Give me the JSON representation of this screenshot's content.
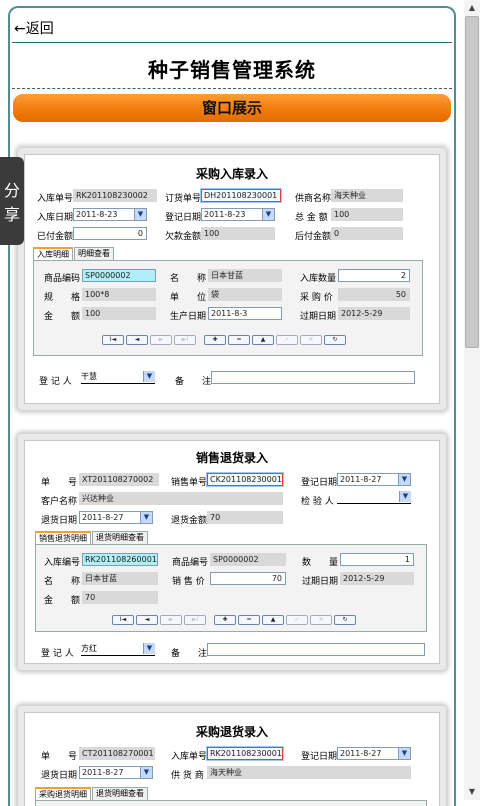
{
  "header": {
    "back_label": "←返回",
    "title": "种子销售管理系统",
    "banner": "窗口展示"
  },
  "share": {
    "label_1": "分",
    "label_2": "享"
  },
  "icons": {
    "back": "back-arrow-icon",
    "dropdown": "chevron-down-icon",
    "scroll_up": "scroll-up-arrow-icon",
    "scroll_down": "scroll-down-arrow-icon"
  },
  "colors": {
    "banner": "#f07a0a",
    "frame_border": "#4e8f8f",
    "share_bg": "#3b3b3b"
  },
  "nav_buttons": [
    "I◄",
    "◄",
    "►",
    "►I",
    "✚",
    "━",
    "▲",
    "✓",
    "✕",
    "↻"
  ],
  "windows": [
    {
      "title": "采购入库录入",
      "fields": {
        "f1_label": "入库单号",
        "f1_value": "RK201108230002",
        "f2_label": "订货单号",
        "f2_value": "DH201108230001",
        "f3_label": "供商名称",
        "f3_value": "海天种业",
        "f4_label": "入库日期",
        "f4_value": "2011-8-23",
        "f5_label": "登记日期",
        "f5_value": "2011-8-23",
        "f6_label": "总 金 额",
        "f6_value": "100",
        "f7_label": "已付金额",
        "f7_value": "0",
        "f8_label": "欠款金额",
        "f8_value": "100",
        "f9_label": "后付金额",
        "f9_value": "0"
      },
      "tabs": [
        "入库明细",
        "明细查看"
      ],
      "detail": {
        "d1_label": "商品编码",
        "d1_value": "SP0000002",
        "d2_label": "名　　称",
        "d2_value": "日本甘蓝",
        "d3_label": "入库数量",
        "d3_value": "2",
        "d4_label": "规　　格",
        "d4_value": "100*8",
        "d5_label": "单　　位",
        "d5_value": "袋",
        "d6_label": "采 购 价",
        "d6_value": "50",
        "d7_label": "金　　额",
        "d7_value": "100",
        "d8_label": "生产日期",
        "d8_value": "2011-8-3",
        "d9_label": "过期日期",
        "d9_value": "2012-5-29"
      },
      "footer": {
        "registrar_label": "登 记 人",
        "registrar_value": "干慧",
        "note_label": "备　　注",
        "note_value": ""
      }
    },
    {
      "title": "销售退货录入",
      "fields": {
        "f1_label": "单　　号",
        "f1_value": "XT201108270002",
        "f2_label": "销售单号",
        "f2_value": "CK201108230001",
        "f3_label": "登记日期",
        "f3_value": "2011-8-27",
        "f4_label": "客户名称",
        "f4_value": "兴达种业",
        "f5_label": "检 验 人",
        "f5_value": "",
        "f6_label": "退货日期",
        "f6_value": "2011-8-27",
        "f7_label": "退货金额",
        "f7_value": "70"
      },
      "tabs": [
        "销售退货明细",
        "退货明细查看"
      ],
      "detail": {
        "d1_label": "入库编号",
        "d1_value": "RK201108260001",
        "d2_label": "商品编号",
        "d2_value": "SP0000002",
        "d3_label": "数　　量",
        "d3_value": "1",
        "d4_label": "名　　称",
        "d4_value": "日本甘蓝",
        "d5_label": "销 售 价",
        "d5_value": "70",
        "d6_label": "过期日期",
        "d6_value": "2012-5-29",
        "d7_label": "金　　额",
        "d7_value": "70"
      },
      "footer": {
        "registrar_label": "登 记 人",
        "registrar_value": "方红",
        "note_label": "备　　注",
        "note_value": ""
      }
    },
    {
      "title": "采购退货录入",
      "fields": {
        "f1_label": "单　　号",
        "f1_value": "CT201108270001",
        "f2_label": "入库单号",
        "f2_value": "RK201108230001",
        "f3_label": "登记日期",
        "f3_value": "2011-8-27",
        "f4_label": "退货日期",
        "f4_value": "2011-8-27",
        "f5_label": "供 货 商",
        "f5_value": "海天种业"
      },
      "tabs": [
        "采购退货明细",
        "退货明细查看"
      ]
    }
  ]
}
